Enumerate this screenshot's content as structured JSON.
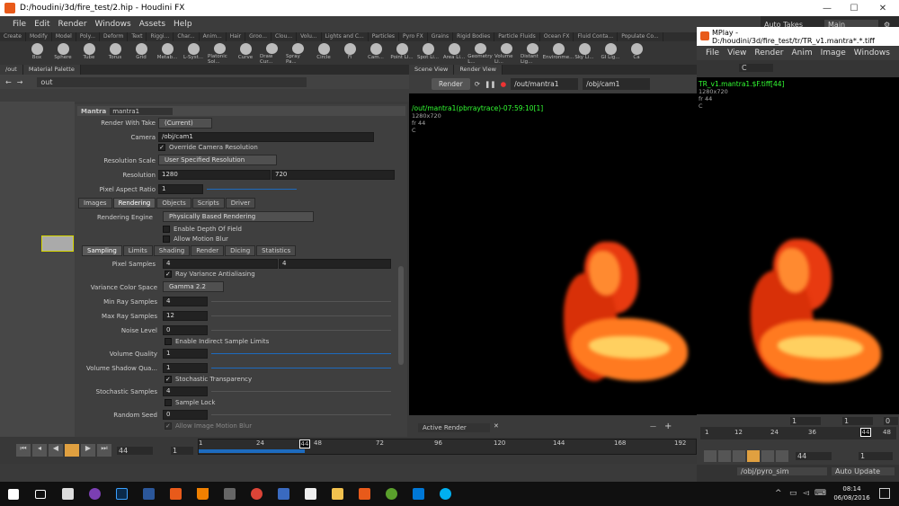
{
  "window": {
    "title": "D:/houdini/3d/fire_test/2.hip - Houdini FX"
  },
  "menu": [
    "File",
    "Edit",
    "Render",
    "Windows",
    "Assets",
    "Help"
  ],
  "shelf_tabs": [
    "Create",
    "Modify",
    "Model",
    "Poly...",
    "Deform",
    "Text",
    "Riggi...",
    "Char...",
    "Anim...",
    "Hair",
    "Groo...",
    "Clou...",
    "Volu...",
    "Lights and C...",
    "Particles",
    "Pyro FX",
    "Grains",
    "Rigid Bodies",
    "Particle Fluids",
    "Ocean FX",
    "Fluid Conta...",
    "Populate Co..."
  ],
  "shelf_tools": [
    "Box",
    "Sphere",
    "Tube",
    "Torus",
    "Grid",
    "Metab...",
    "L-Syst...",
    "Platonic Sol...",
    "Curve",
    "Draw Cur...",
    "Spray Pa...",
    "Circle",
    "Fi",
    "Cam...",
    "Point Li...",
    "Spot Li...",
    "Area Li...",
    "Geometry L...",
    "Volume Li...",
    "Distant Lig...",
    "Environme...",
    "Sky Li...",
    "GI Lig...",
    "Ca"
  ],
  "topright": {
    "auto_takes": "Auto Takes",
    "desktop": "Main"
  },
  "left_tabs": [
    "/out",
    "Material Palette"
  ],
  "path": "out",
  "mantra": {
    "type": "Mantra",
    "name": "mantra1",
    "render_with_take_label": "Render With Take",
    "render_with_take": "(Current)",
    "camera_label": "Camera",
    "camera": "/obj/cam1",
    "override_res": "Override Camera Resolution",
    "res_scale_label": "Resolution Scale",
    "res_scale": "User Specified Resolution",
    "resolution_label": "Resolution",
    "res_x": "1280",
    "res_y": "720",
    "pixel_aspect_label": "Pixel Aspect Ratio",
    "pixel_aspect": "1",
    "main_tabs": [
      "Images",
      "Rendering",
      "Objects",
      "Scripts",
      "Driver"
    ],
    "engine_label": "Rendering Engine",
    "engine": "Physically Based Rendering",
    "dof": "Enable Depth Of Field",
    "motion_blur": "Allow Motion Blur",
    "sub_tabs": [
      "Sampling",
      "Limits",
      "Shading",
      "Render",
      "Dicing",
      "Statistics"
    ],
    "pixel_samples_label": "Pixel Samples",
    "pixel_samples_x": "4",
    "pixel_samples_y": "4",
    "ray_var": "Ray Variance Antialiasing",
    "var_color_label": "Variance Color Space",
    "var_color": "Gamma 2.2",
    "min_ray_label": "Min Ray Samples",
    "min_ray": "4",
    "max_ray_label": "Max Ray Samples",
    "max_ray": "12",
    "noise_label": "Noise Level",
    "noise": "0",
    "indirect": "Enable Indirect Sample Limits",
    "vol_quality_label": "Volume Quality",
    "vol_quality": "1",
    "vol_shadow_label": "Volume Shadow Qua...",
    "vol_shadow": "1",
    "stoch_transp": "Stochastic Transparency",
    "stoch_samples_label": "Stochastic Samples",
    "stoch_samples": "4",
    "sample_lock": "Sample Lock",
    "seed_label": "Random Seed",
    "seed": "0",
    "img_motion_blur": "Allow Image Motion Blur"
  },
  "scene_tabs": [
    "Scene View",
    "Render View"
  ],
  "render_view": {
    "render_btn": "Render",
    "rop": "/out/mantra1",
    "cam": "/obj/cam1",
    "info1": "/out/mantra1(pbrraytrace)-07:59:10[1]",
    "info2": "1280x720",
    "info3": "fr 44",
    "info4": "C",
    "active_render": "Active Render"
  },
  "timeline": {
    "frame": "44",
    "start": "1",
    "ticks": [
      "1",
      "24",
      "44",
      "48",
      "72",
      "96",
      "120",
      "144",
      "168",
      "192"
    ]
  },
  "mplay": {
    "title": "MPlay - D:/houdini/3d/fire_test/tr/TR_v1.mantra*.*.tiff",
    "menu": [
      "File",
      "View",
      "Render",
      "Anim",
      "Image",
      "Windows"
    ],
    "channel": "C",
    "info1": "TR_v1.mantra1.$F.tiff[44]",
    "info2": "1280x720",
    "info3": "fr 44",
    "info4": "C",
    "ticks": [
      "1",
      "12",
      "24",
      "36",
      "44",
      "48"
    ],
    "frame": "44",
    "start": "1",
    "path": "/obj/pyro_sim",
    "update": "Auto Update",
    "val1": "1",
    "val2": "1",
    "val3": "0"
  },
  "taskbar": {
    "time": "08:14",
    "date": "06/08/2016"
  }
}
